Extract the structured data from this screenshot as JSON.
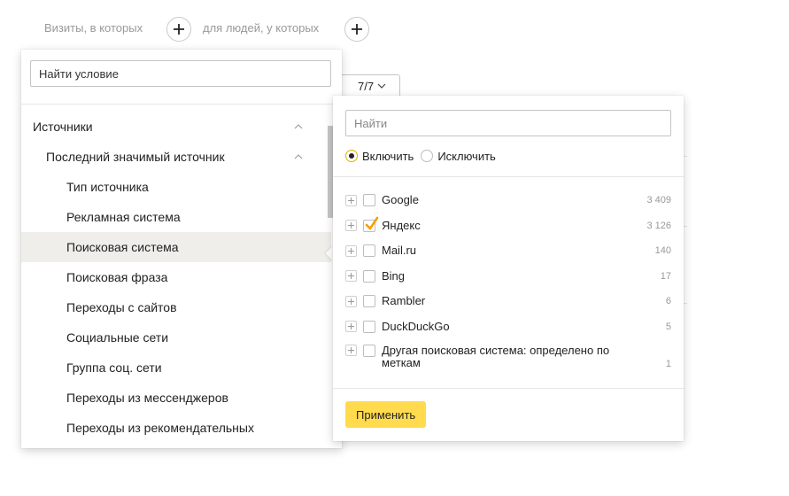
{
  "segment_bar": {
    "visits_label": "Визиты, в которых",
    "people_label": "для людей, у которых"
  },
  "left_panel": {
    "search_placeholder": "Найти условие",
    "items": [
      {
        "label": "Источники",
        "level": 0,
        "expanded": true
      },
      {
        "label": "Последний значимый источник",
        "level": 1,
        "expanded": true
      },
      {
        "label": "Тип источника",
        "level": 2
      },
      {
        "label": "Рекламная система",
        "level": 2
      },
      {
        "label": "Поисковая система",
        "level": 2,
        "selected": true
      },
      {
        "label": "Поисковая фраза",
        "level": 2
      },
      {
        "label": "Переходы с сайтов",
        "level": 2
      },
      {
        "label": "Социальные сети",
        "level": 2
      },
      {
        "label": "Группа соц. сети",
        "level": 2
      },
      {
        "label": "Переходы из мессенджеров",
        "level": 2
      },
      {
        "label": "Переходы из рекомендательных",
        "level": 2
      }
    ]
  },
  "count_button": {
    "label": "7/7"
  },
  "right_panel": {
    "search_placeholder": "Найти",
    "include_label": "Включить",
    "exclude_label": "Исключить",
    "mode": "include",
    "options": [
      {
        "label": "Google",
        "count": "3 409",
        "checked": false
      },
      {
        "label": "Яндекс",
        "count": "3 126",
        "checked": true
      },
      {
        "label": "Mail.ru",
        "count": "140",
        "checked": false
      },
      {
        "label": "Bing",
        "count": "17",
        "checked": false
      },
      {
        "label": "Rambler",
        "count": "6",
        "checked": false
      },
      {
        "label": "DuckDuckGo",
        "count": "5",
        "checked": false
      },
      {
        "label": "Другая поисковая система: определено по меткам",
        "count": "1",
        "checked": false
      }
    ],
    "apply_label": "Применить"
  },
  "colors": {
    "accent_yellow": "#ffdb4d",
    "check_orange": "#f5a000",
    "selected_row_bg": "#f0eeea"
  },
  "icons": {
    "add": "plus-icon",
    "collapse": "chevron-up-icon",
    "dropdown": "chevron-down-icon",
    "expand_option": "plus-square-icon",
    "checkmark": "checkmark-icon"
  }
}
